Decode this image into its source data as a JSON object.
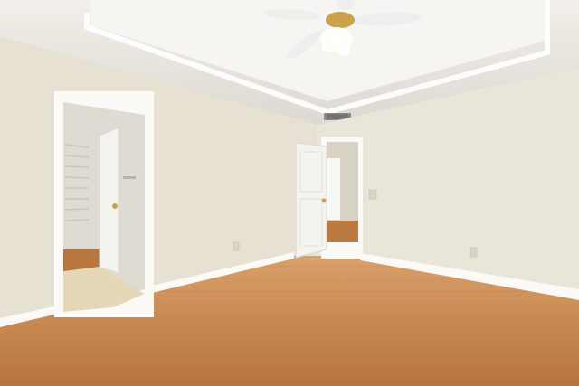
{
  "scene": {
    "kind": "empty-bedroom-photo",
    "colors": {
      "ceiling": "#f1efe9",
      "ceiling_shadow": "#dcd9d1",
      "tray_ceiling": "#f6f5f1",
      "wall_left": "#e6e1d3",
      "wall_right": "#e9e5d9",
      "wall_back": "#e3ddce",
      "trim": "#f8f7f3",
      "door": "#f4f3ee",
      "floor_light": "#d9a06a",
      "floor_mid": "#c98a52",
      "floor_dark": "#b7733e",
      "tile": "#e6d7b8",
      "closet_wall": "#dedbd3",
      "fan_blade": "#eeeeee",
      "fan_brass": "#c9a24a",
      "outlet": "#d9d4c6"
    },
    "objects": [
      "ceiling-fan-icon",
      "hvac-vent",
      "closet-doorway",
      "closet-door",
      "hall-doorway",
      "hall-door",
      "light-switch",
      "wall-outlet",
      "hardwood-floor",
      "baseboard"
    ]
  }
}
